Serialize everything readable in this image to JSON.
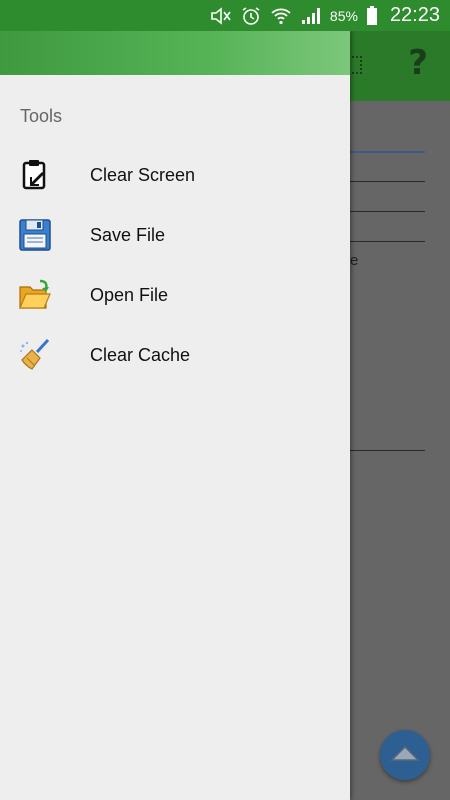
{
  "status_bar": {
    "battery_percent": "85%",
    "time": "22:23",
    "icons": [
      "mute-icon",
      "alarm-icon",
      "wifi-icon",
      "signal-icon",
      "battery-icon"
    ]
  },
  "app": {
    "toolbar_icons": [
      "grid-icon",
      "help-icon"
    ],
    "help_glyph": "?",
    "partial_text": "e",
    "fab_icon": "chevron-up-icon"
  },
  "drawer": {
    "section_title": "Tools",
    "items": [
      {
        "label": "Clear Screen",
        "icon": "clipboard-icon"
      },
      {
        "label": "Save File",
        "icon": "floppy-disk-icon"
      },
      {
        "label": "Open File",
        "icon": "open-folder-icon"
      },
      {
        "label": "Clear Cache",
        "icon": "broom-icon"
      }
    ]
  },
  "colors": {
    "status_bar": "#2e8b2e",
    "toolbar": "#2a7a2a",
    "drawer_bg": "#eeeeee",
    "fab": "#2d5f93"
  }
}
